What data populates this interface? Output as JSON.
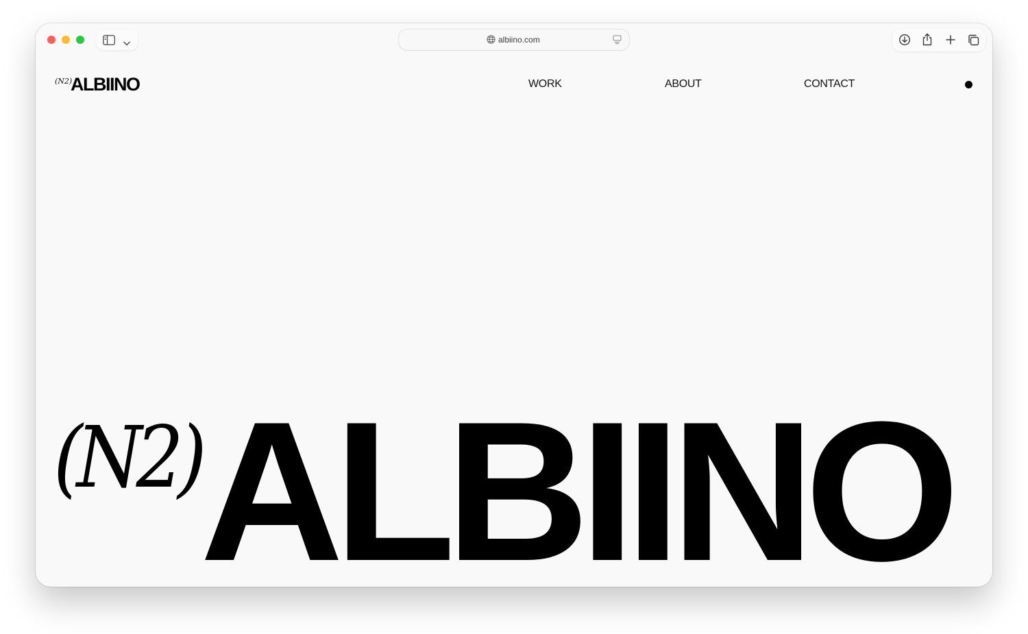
{
  "browser": {
    "url": "albiino.com",
    "icons": {
      "sidebar": "sidebar-icon",
      "chevron": "chevron-down-icon",
      "globe": "globe-icon",
      "reader": "reader-icon",
      "download": "download-icon",
      "share": "share-icon",
      "new_tab": "plus-icon",
      "tabs": "tab-overview-icon"
    },
    "traffic_colors": {
      "close": "#ff5f57",
      "minimize": "#febc2e",
      "zoom": "#28c840"
    }
  },
  "site": {
    "logo": {
      "prefix": "(N2)",
      "name": "ALBIINO"
    },
    "nav": {
      "work": "WORK",
      "about": "ABOUT",
      "contact": "CONTACT"
    },
    "hero": {
      "prefix": "(N2)",
      "name": "ALBIINO"
    },
    "menu_icon": "menu-dot-icon"
  }
}
